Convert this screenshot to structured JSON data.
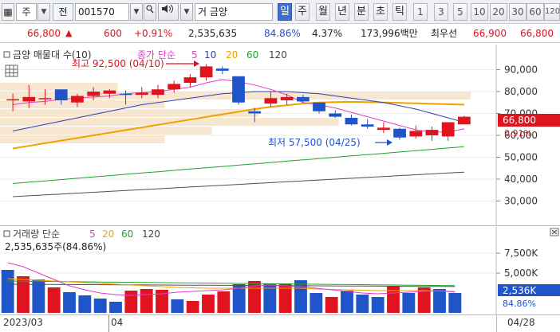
{
  "toolbar": {
    "market_type": "주",
    "flag": "전",
    "code": "001570",
    "name": "금양",
    "name_prefix": "거",
    "periods": [
      {
        "label": "일",
        "active": true
      },
      {
        "label": "주",
        "active": false
      },
      {
        "label": "월",
        "active": false
      },
      {
        "label": "년",
        "active": false
      },
      {
        "label": "분",
        "active": false
      },
      {
        "label": "초",
        "active": false
      },
      {
        "label": "틱",
        "active": false
      }
    ],
    "intervals": [
      "1",
      "3",
      "5",
      "10",
      "20",
      "30",
      "60",
      "120"
    ]
  },
  "quote": {
    "price": "66,800",
    "change_arrow": "▲",
    "change": "600",
    "change_pct": "+0.91%",
    "volume": "2,535,635",
    "volume_ratio": "84.86%",
    "turnover": "4.37%",
    "amount": "173,996백만",
    "best_ask_label": "최우선",
    "best_ask": "66,900",
    "best_bid": "66,800"
  },
  "price_legend": {
    "title": "금양 매물대 수(10)",
    "ma_label": "종가 단순",
    "ma_periods": [
      "5",
      "10",
      "20",
      "60",
      "120"
    ]
  },
  "annotations": {
    "high": "최고 92,500 (04/10)",
    "low": "최저 57,500 (04/25)"
  },
  "price_axis": {
    "ticks": [
      "90,000",
      "80,000",
      "70,000",
      "60,000",
      "50,000",
      "40,000",
      "30,000"
    ],
    "current_price": "66,800",
    "current_pct": "0.91%"
  },
  "volume_legend": {
    "label": "거래량 단순",
    "ma_periods": [
      "5",
      "20",
      "60",
      "120"
    ],
    "value": "2,535,635주(84.86%)"
  },
  "volume_axis": {
    "ticks": [
      "7,500K",
      "5,000K"
    ],
    "current": "2,536K",
    "current_pct": "84.86%"
  },
  "x_axis": {
    "labels": [
      "2023/03",
      "04",
      "04/28"
    ]
  },
  "colors": {
    "up": "#e0141e",
    "down": "#1f55c9",
    "ma5": "#e03cc9",
    "ma10": "#2b3fb8",
    "ma20": "#f0a000",
    "ma60": "#22a02c",
    "ma120": "#505050",
    "profile": "#f6e3c8"
  },
  "chart_data": {
    "type": "candlestick",
    "price_ylim": [
      20000,
      100000
    ],
    "candles": [
      {
        "o": 76000,
        "h": 79000,
        "l": 71000,
        "c": 76500
      },
      {
        "o": 75500,
        "h": 83000,
        "l": 72500,
        "c": 77500
      },
      {
        "o": 77000,
        "h": 81000,
        "l": 74000,
        "c": 77000
      },
      {
        "o": 81000,
        "h": 81000,
        "l": 74000,
        "c": 76000
      },
      {
        "o": 75000,
        "h": 79000,
        "l": 73000,
        "c": 78000
      },
      {
        "o": 78000,
        "h": 82000,
        "l": 76000,
        "c": 80000
      },
      {
        "o": 79000,
        "h": 81000,
        "l": 77000,
        "c": 80500
      },
      {
        "o": 79000,
        "h": 80500,
        "l": 74000,
        "c": 78500
      },
      {
        "o": 78500,
        "h": 82000,
        "l": 77000,
        "c": 79500
      },
      {
        "o": 78500,
        "h": 83000,
        "l": 77000,
        "c": 81000
      },
      {
        "o": 81000,
        "h": 85000,
        "l": 79500,
        "c": 83500
      },
      {
        "o": 84000,
        "h": 88000,
        "l": 82000,
        "c": 86500
      },
      {
        "o": 86500,
        "h": 92500,
        "l": 85000,
        "c": 91500
      },
      {
        "o": 90500,
        "h": 91500,
        "l": 88000,
        "c": 89500
      },
      {
        "o": 87000,
        "h": 87000,
        "l": 74000,
        "c": 75000
      },
      {
        "o": 71000,
        "h": 72500,
        "l": 66000,
        "c": 70000
      },
      {
        "o": 74500,
        "h": 80000,
        "l": 73000,
        "c": 77000
      },
      {
        "o": 76000,
        "h": 79000,
        "l": 74000,
        "c": 77500
      },
      {
        "o": 77500,
        "h": 78500,
        "l": 75000,
        "c": 75500
      },
      {
        "o": 75000,
        "h": 75000,
        "l": 70000,
        "c": 71000
      },
      {
        "o": 70000,
        "h": 71500,
        "l": 68000,
        "c": 68500
      },
      {
        "o": 68000,
        "h": 69500,
        "l": 64500,
        "c": 65000
      },
      {
        "o": 65000,
        "h": 67500,
        "l": 63000,
        "c": 64000
      },
      {
        "o": 62500,
        "h": 66000,
        "l": 61000,
        "c": 63500
      },
      {
        "o": 63000,
        "h": 63500,
        "l": 58000,
        "c": 59000
      },
      {
        "o": 59500,
        "h": 64500,
        "l": 58500,
        "c": 62000
      },
      {
        "o": 60000,
        "h": 64000,
        "l": 57500,
        "c": 62500
      },
      {
        "o": 59500,
        "h": 66000,
        "l": 57500,
        "c": 66000
      },
      {
        "o": 65000,
        "h": 69000,
        "l": 65000,
        "c": 68500
      }
    ],
    "ma5": [
      74000,
      75000,
      75500,
      76500,
      77000,
      77500,
      78000,
      79000,
      79500,
      80000,
      81000,
      82000,
      84000,
      85500,
      84500,
      83000,
      81000,
      78500,
      75000,
      74000,
      72500,
      70500,
      68500,
      66500,
      64500,
      62500,
      61500,
      61500,
      63000
    ],
    "ma10": [
      62000,
      63500,
      65000,
      66500,
      68000,
      69500,
      71000,
      72500,
      74000,
      75000,
      76000,
      77000,
      78000,
      79000,
      79500,
      80000,
      80000,
      80000,
      79500,
      79000,
      78000,
      77000,
      76000,
      75000,
      73500,
      72000,
      70000,
      68000,
      66000
    ],
    "ma20": [
      54000,
      55200,
      56400,
      57600,
      58800,
      60000,
      61200,
      62400,
      63600,
      64800,
      66000,
      67200,
      68400,
      69600,
      70800,
      72000,
      73000,
      73800,
      74500,
      75000,
      75200,
      75300,
      75200,
      75000,
      74800,
      74600,
      74400,
      74200,
      74000
    ],
    "ma60": [
      38000,
      38600,
      39200,
      39800,
      40400,
      41000,
      41600,
      42200,
      42800,
      43400,
      44000,
      44600,
      45200,
      45800,
      46400,
      47000,
      47600,
      48200,
      48800,
      49400,
      50000,
      50600,
      51200,
      51800,
      52400,
      53000,
      53600,
      54200,
      54800
    ],
    "ma120": [
      32000,
      32400,
      32800,
      33200,
      33600,
      34000,
      34400,
      34800,
      35200,
      35600,
      36000,
      36400,
      36800,
      37200,
      37600,
      38000,
      38400,
      38800,
      39200,
      39600,
      40000,
      40400,
      40800,
      41200,
      41600,
      42000,
      42400,
      42800,
      43200
    ],
    "volume_profile": [
      {
        "low": 80000,
        "high": 84000,
        "size": 0.25
      },
      {
        "low": 76000,
        "high": 80000,
        "size": 1.0
      },
      {
        "low": 72000,
        "high": 76000,
        "size": 0.35
      },
      {
        "low": 68000,
        "high": 72000,
        "size": 0.55
      },
      {
        "low": 64000,
        "high": 68000,
        "size": 0.72
      },
      {
        "low": 60000,
        "high": 64000,
        "size": 0.45
      },
      {
        "low": 56000,
        "high": 60000,
        "size": 0.35
      }
    ],
    "volume_ylim": [
      0,
      10000000
    ],
    "volumes": [
      5400000,
      4600000,
      4200000,
      3200000,
      2600000,
      2200000,
      1800000,
      1400000,
      2800000,
      3000000,
      2900000,
      1700000,
      1500000,
      2300000,
      2700000,
      3600000,
      4000000,
      3700000,
      3700000,
      4100000,
      2500000,
      2000000,
      2800000,
      2300000,
      2000000,
      3300000,
      2500000,
      3200000,
      3000000,
      2500000
    ],
    "volume_up": [
      false,
      true,
      false,
      true,
      false,
      false,
      false,
      false,
      true,
      true,
      true,
      false,
      true,
      true,
      true,
      false,
      true,
      false,
      true,
      false,
      false,
      true,
      false,
      false,
      false,
      true,
      false,
      true,
      false,
      false
    ],
    "volume_ma5": [
      6300000,
      5800000,
      5000000,
      4200000,
      3400000,
      2900000,
      2500000,
      2300000,
      2200000,
      2300000,
      2400000,
      2600000,
      2700000,
      2800000,
      2900000,
      3100000,
      3400000,
      3500000,
      3400000,
      3300000,
      3100000,
      2900000,
      2700000,
      2500000,
      2400000,
      2500000,
      2600000,
      2700000,
      2800000,
      2600000
    ],
    "volume_ma20": [
      4300000,
      4200000,
      4100000,
      4000000,
      3900000,
      3800000,
      3700000,
      3600000,
      3500000,
      3400000,
      3300000,
      3200000,
      3150000,
      3100000,
      3100000,
      3100000,
      3100000,
      3100000,
      3100000,
      3100000,
      3000000,
      2950000,
      2900000,
      2850000,
      2800000,
      2800000,
      2800000,
      2800000,
      2750000,
      2700000
    ],
    "volume_ma60": [
      4000000,
      3980000,
      3960000,
      3940000,
      3920000,
      3900000,
      3880000,
      3860000,
      3840000,
      3820000,
      3800000,
      3780000,
      3760000,
      3740000,
      3720000,
      3700000,
      3680000,
      3660000,
      3640000,
      3620000,
      3600000,
      3580000,
      3560000,
      3540000,
      3520000,
      3500000,
      3480000,
      3460000,
      3440000,
      3420000
    ],
    "volume_ma120": [
      3600000,
      3590000,
      3580000,
      3570000,
      3560000,
      3550000,
      3540000,
      3530000,
      3520000,
      3510000,
      3500000,
      3490000,
      3480000,
      3470000,
      3460000,
      3450000,
      3440000,
      3430000,
      3420000,
      3410000,
      3400000,
      3390000,
      3380000,
      3370000,
      3360000,
      3350000,
      3340000,
      3330000,
      3320000,
      3310000
    ]
  }
}
